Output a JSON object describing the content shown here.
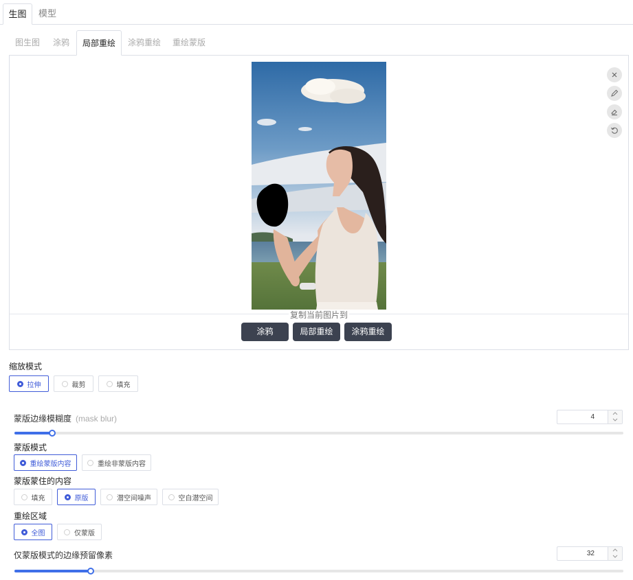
{
  "top_tabs": [
    {
      "label": "生图",
      "active": true
    },
    {
      "label": "模型",
      "active": false
    }
  ],
  "sub_tabs": [
    {
      "label": "图生图",
      "active": false
    },
    {
      "label": "涂鸦",
      "active": false
    },
    {
      "label": "局部重绘",
      "active": true
    },
    {
      "label": "涂鸦重绘",
      "active": false
    },
    {
      "label": "重绘蒙版",
      "active": false
    }
  ],
  "image_panel": {
    "toolbar_icons": [
      "close-icon",
      "pencil-icon",
      "eraser-icon",
      "undo-icon"
    ],
    "copy_to_label": "复制当前图片到",
    "send_buttons": [
      "涂鸦",
      "局部重绘",
      "涂鸦重绘"
    ]
  },
  "resize_mode": {
    "label": "缩放模式",
    "options": [
      "拉伸",
      "裁剪",
      "填充"
    ],
    "selected": "拉伸"
  },
  "mask_blur": {
    "label": "蒙版边缘模糊度",
    "hint": "(mask blur)",
    "value": "4",
    "min": 0,
    "max": 64
  },
  "mask_mode": {
    "label": "蒙版模式",
    "options": [
      "重绘蒙版内容",
      "重绘非蒙版内容"
    ],
    "selected": "重绘蒙版内容"
  },
  "masked_content": {
    "label": "蒙版蒙住的内容",
    "options": [
      "填充",
      "原版",
      "潜空间噪声",
      "空白潜空间"
    ],
    "selected": "原版"
  },
  "inpaint_area": {
    "label": "重绘区域",
    "options": [
      "全图",
      "仅蒙版"
    ],
    "selected": "全图"
  },
  "only_masked_padding": {
    "label": "仅蒙版模式的边缘预留像素",
    "value": "32",
    "min": 0,
    "max": 256
  },
  "colors": {
    "accent": "#3f5bd8",
    "slider": "#3f6fe8",
    "button_dark": "#3c4250"
  }
}
